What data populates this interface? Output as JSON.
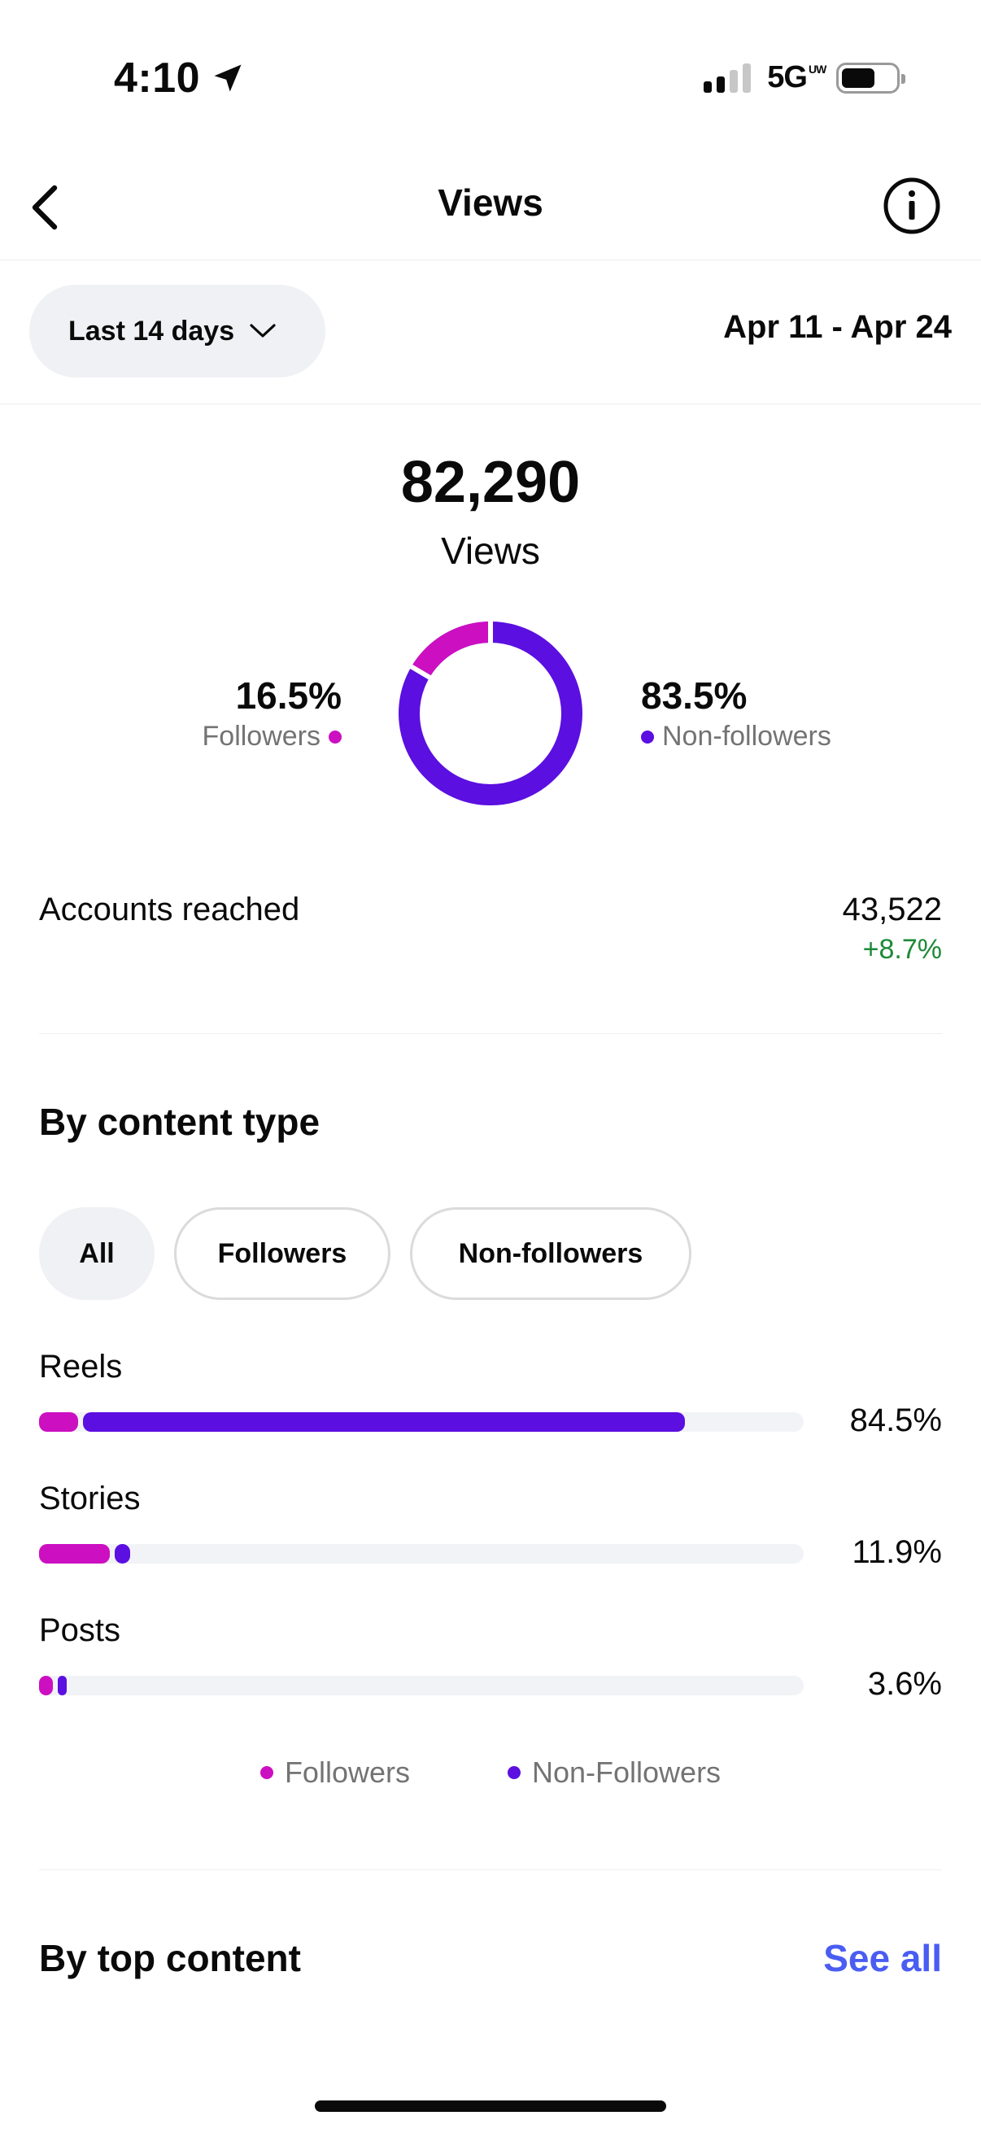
{
  "status_bar": {
    "time": "4:10",
    "network": "5G",
    "network_badge": "UW",
    "icons": [
      "location-arrow-icon",
      "signal-icon",
      "battery-icon"
    ]
  },
  "nav": {
    "title": "Views",
    "back_icon": "chevron-left-icon",
    "info_icon": "info-circle-icon"
  },
  "filter": {
    "range_label": "Last 14 days",
    "dropdown_icon": "chevron-down-icon",
    "date_range": "Apr 11 - Apr 24"
  },
  "summary": {
    "total": "82,290",
    "total_label": "Views",
    "followers_pct": "16.5%",
    "followers_label": "Followers",
    "non_followers_pct": "83.5%",
    "non_followers_label": "Non-followers",
    "followers_fraction": 0.165
  },
  "accounts": {
    "label": "Accounts reached",
    "value": "43,522",
    "change": "+8.7%"
  },
  "content_type": {
    "title": "By content type",
    "chips": [
      "All",
      "Followers",
      "Non-followers"
    ],
    "active_chip": "All",
    "rows": [
      {
        "label": "Reels",
        "pct": "84.5%",
        "followers": 0.051,
        "non_followers": 0.794
      },
      {
        "label": "Stories",
        "pct": "11.9%",
        "followers": 0.093,
        "non_followers": 0.026
      },
      {
        "label": "Posts",
        "pct": "3.6%",
        "followers": 0.018,
        "non_followers": 0.018
      }
    ],
    "legend": [
      "Followers",
      "Non-Followers"
    ]
  },
  "top_content": {
    "title": "By top content",
    "see_all": "See all"
  },
  "colors": {
    "followers": "#cc0fc1",
    "non_followers": "#5b0fe0",
    "positive": "#1d8a38",
    "link": "#4a5df2"
  }
}
